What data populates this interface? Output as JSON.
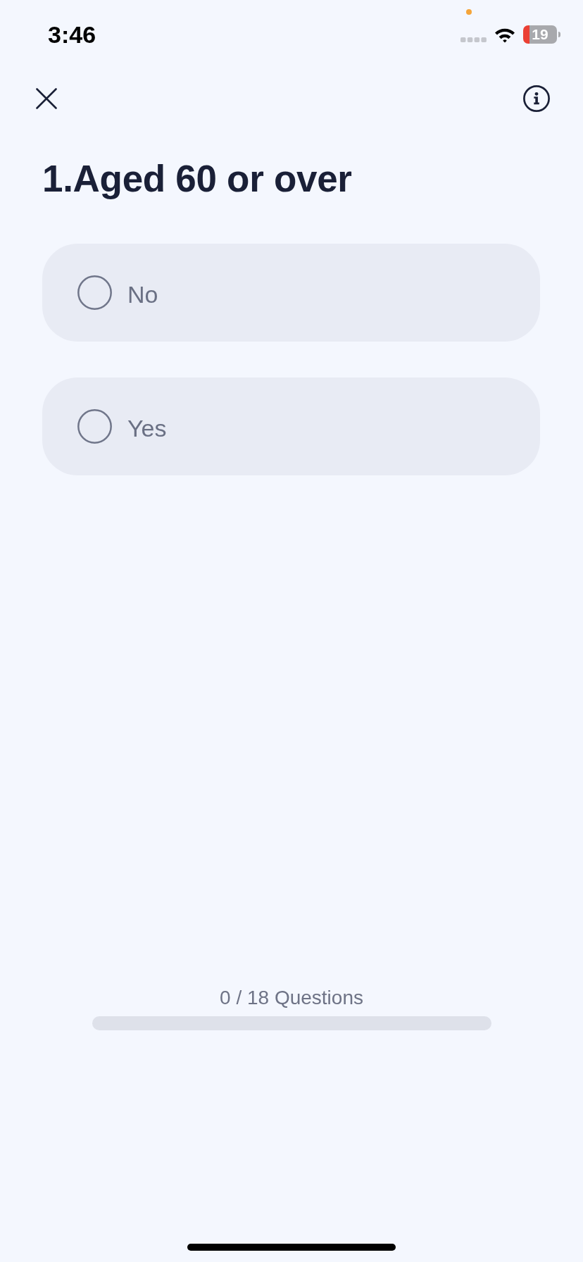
{
  "status_bar": {
    "time": "3:46",
    "battery": "19"
  },
  "question": {
    "title": "1.Aged 60 or over"
  },
  "options": [
    {
      "label": "No",
      "selected": false
    },
    {
      "label": "Yes",
      "selected": false
    }
  ],
  "progress": {
    "label": "0 / 18 Questions",
    "level": 0
  }
}
